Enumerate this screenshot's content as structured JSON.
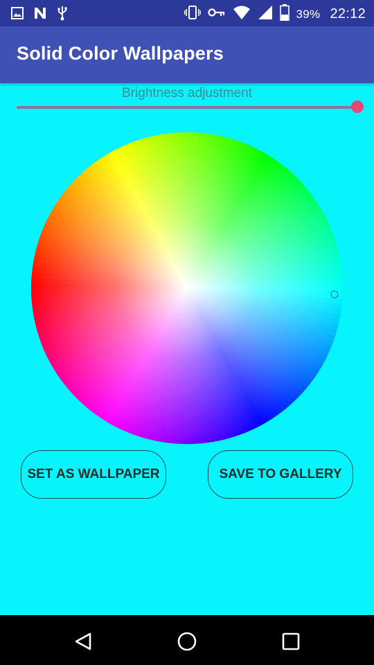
{
  "status_bar": {
    "battery": "39%",
    "time": "22:12",
    "icons_left": [
      "image-icon",
      "n-letter-icon",
      "usb-icon"
    ],
    "icons_right": [
      "vibrate-icon",
      "key-icon",
      "wifi-icon",
      "signal-icon",
      "battery-icon"
    ]
  },
  "app_bar": {
    "title": "Solid Color Wallpapers"
  },
  "brightness": {
    "label": "Brightness adjustment",
    "level": 1.0,
    "track_color": "#9b6a9c",
    "thumb_color": "#e8457a"
  },
  "color_wheel": {
    "selected_color": "#08f4fc"
  },
  "buttons": {
    "set_wallpaper": "SET AS WALLPAPER",
    "save_gallery": "SAVE TO GALLERY"
  },
  "nav_bar": {
    "icons": [
      "back-icon",
      "home-icon",
      "recents-icon"
    ]
  },
  "colors": {
    "background": "#08f4fc",
    "app_bar": "#3f51b5",
    "status_bar": "#2c399b"
  }
}
